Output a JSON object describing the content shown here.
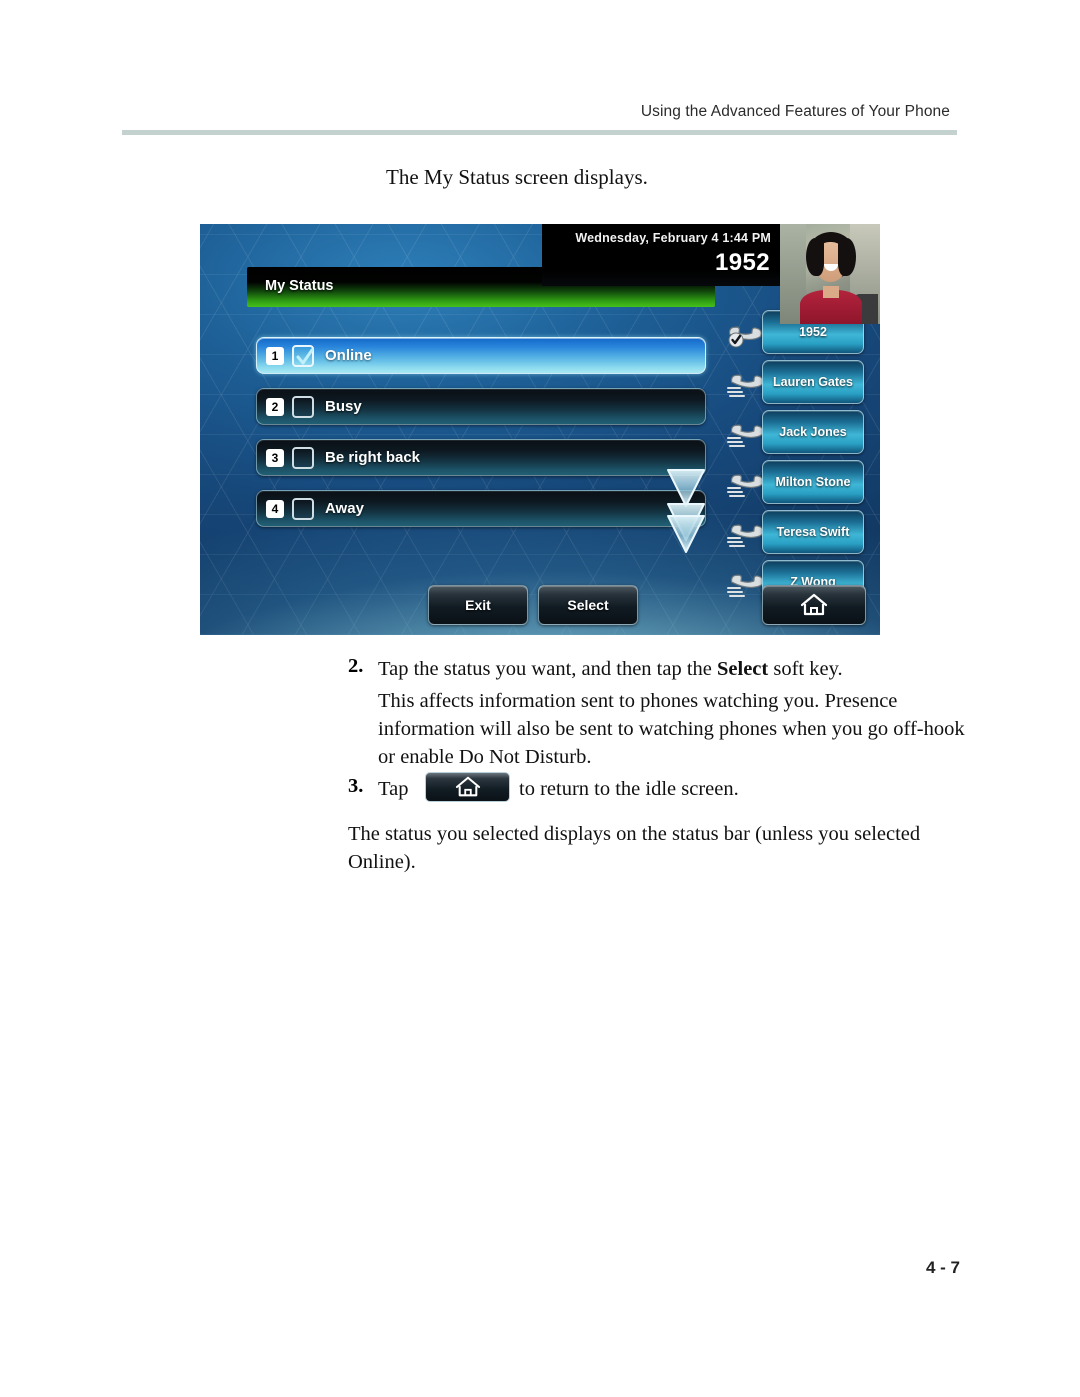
{
  "header": {
    "title": "Using the Advanced Features of Your Phone"
  },
  "intro": {
    "text": "The My Status screen displays."
  },
  "phone_screen": {
    "status_bar": {
      "datetime": "Wednesday, February 4  1:44 PM",
      "extension": "1952"
    },
    "title_bar": {
      "label": "My Status"
    },
    "status_options": [
      {
        "num": "1",
        "label": "Online",
        "checked": true
      },
      {
        "num": "2",
        "label": "Busy",
        "checked": false
      },
      {
        "num": "3",
        "label": "Be right back",
        "checked": false
      },
      {
        "num": "4",
        "label": "Away",
        "checked": false
      }
    ],
    "line_keys": [
      {
        "label": "1952",
        "icon": "handset-check-icon"
      },
      {
        "label": "Lauren Gates",
        "icon": "handset-icon"
      },
      {
        "label": "Jack Jones",
        "icon": "handset-icon"
      },
      {
        "label": "Milton Stone",
        "icon": "handset-icon"
      },
      {
        "label": "Teresa Swift",
        "icon": "handset-icon"
      },
      {
        "label": "Z Wong",
        "icon": "handset-icon"
      }
    ],
    "soft_keys": {
      "exit": "Exit",
      "select": "Select",
      "home_icon": "home-icon"
    },
    "scroll_indicator": "chevron-down-icon",
    "colors": {
      "title_bar_accent": "#45c01a",
      "selected_row": "#59b6e4",
      "line_key": "#3fb6d6",
      "status_bar_bg": "#000000"
    }
  },
  "steps": {
    "step2": {
      "number": "2.",
      "text_before": "Tap the status you want, and then tap the ",
      "bold": "Select",
      "text_after": " soft key.",
      "body": "This affects information sent to phones watching you. Presence information will also be sent to watching phones when you go off-hook or enable Do Not Disturb."
    },
    "step3": {
      "number": "3.",
      "tap_word": "Tap",
      "button_icon": "home-icon",
      "text_after": "to return to the idle screen."
    }
  },
  "closing": {
    "text": "The status you selected displays on the status bar (unless you selected Online)."
  },
  "footer": {
    "page_number": "4 - 7"
  }
}
